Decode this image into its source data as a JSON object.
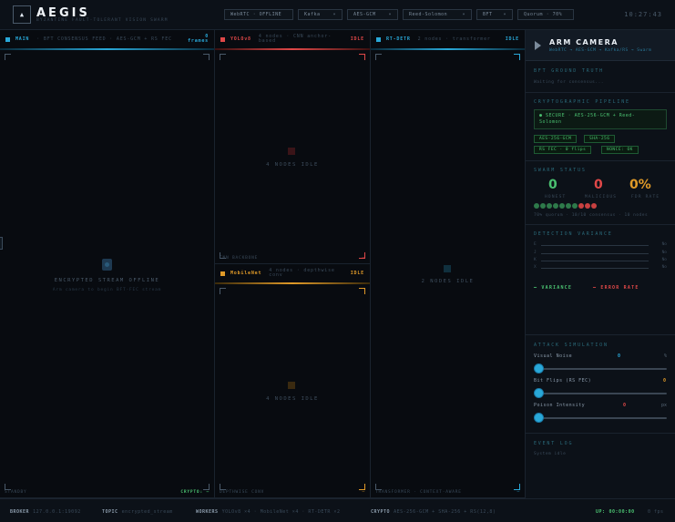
{
  "header": {
    "logo_glyph": "▲",
    "title": "AEGIS",
    "subtitle": "BYZANTINE FAULT-TOLERANT VISION SWARM",
    "pills": [
      {
        "label": "WebRTC · OFFLINE",
        "chev": ""
      },
      {
        "label": "Kafka",
        "chev": "▾"
      },
      {
        "label": "AES-GCM",
        "chev": "▾"
      },
      {
        "label": "Reed-Solomon",
        "chev": "▾"
      },
      {
        "label": "BFT",
        "chev": "▾"
      },
      {
        "label": "Quorum · 70%",
        "chev": ""
      }
    ],
    "clock": "10:27:43"
  },
  "main_panel": {
    "name": "MAIN",
    "desc": "· BFT CONSENSUS FEED · AES-GCM + RS FEC",
    "frames_num": "0",
    "frames_label": "frames",
    "color": "#29a8d8",
    "offline_title": "ENCRYPTED STREAM OFFLINE",
    "offline_sub": "Arm camera to begin BFT-FEC stream",
    "foot_left": "STANDBY",
    "foot_right_label": "CRYPTO:",
    "foot_right_val": "—"
  },
  "yolo_panel": {
    "name": "YOLOv8",
    "desc": "4 nodes · CNN anchor-based",
    "state": "IDLE",
    "color": "#e04848",
    "center": "4 NODES IDLE",
    "foot_left": "CNN BACKBONE",
    "foot_right": "—"
  },
  "rtdetr_panel": {
    "name": "RT-DETR",
    "desc": "2 nodes · transformer",
    "state": "IDLE",
    "color": "#29a8d8",
    "center": "2 NODES IDLE",
    "foot_left": "TRANSFORMER · CONTEXT-AWARE",
    "foot_right": "—"
  },
  "mobilenet_panel": {
    "name": "MobileNet",
    "desc": "4 nodes · depthwise conv",
    "state": "IDLE",
    "color": "#e09a28",
    "center": "4 NODES IDLE",
    "foot_left": "DEPTHWISE CONV",
    "foot_right": "—"
  },
  "sidebar": {
    "arm_title": "ARM CAMERA",
    "arm_sub": "WebRTC → AES-GCM → Kafka/RS → Swarm",
    "bft_title": "BFT GROUND TRUTH",
    "bft_text": "Waiting for consensus...",
    "crypto_title": "CRYPTOGRAPHIC PIPELINE",
    "crypto_secure_line1": "● SECURE · AES-256-GCM + Reed-",
    "crypto_secure_line2": "Solomon",
    "crypto_tags": [
      "AES-256-GCM",
      "SHA-256",
      "RS FEC · 0 flips",
      "NONCE: OK"
    ],
    "swarm_title": "SWARM STATUS",
    "honest_num": "0",
    "honest_label": "HONEST",
    "malicious_num": "0",
    "malicious_label": "MALICIOUS",
    "fdr_num": "0%",
    "fdr_label": "FDR RATE",
    "swarm_nodes": {
      "honest": 7,
      "malicious": 3
    },
    "swarm_text": "70% quorum · 10/10 consensus · 10 nodes",
    "variance_title": "DETECTION VARIANCE",
    "variance_rows": [
      {
        "label": "E",
        "value": "No"
      },
      {
        "label": "J",
        "value": "No"
      },
      {
        "label": "K",
        "value": "No"
      },
      {
        "label": "X",
        "value": "No"
      }
    ],
    "legend_variance": "━ VARIANCE",
    "legend_error": "━ ERROR RATE",
    "attack_title": "ATTACK SIMULATION",
    "sliders": [
      {
        "label": "Visual Noise",
        "value": "0",
        "unit": "%",
        "level": 0
      },
      {
        "label": "Bit Flips (RS FEC)",
        "value": "0",
        "unit": "",
        "level": 0
      },
      {
        "label": "Poison Intensity",
        "value": "0",
        "unit": "px",
        "level": 0
      }
    ],
    "event_title": "EVENT LOG",
    "event_text": "System idle"
  },
  "footer": {
    "broker_label": "BROKER",
    "broker_val": "127.0.0.1:19092",
    "topic_label": "TOPIC",
    "topic_val": "encrypted_stream",
    "workers_label": "WORKERS",
    "workers_val": "YOLOv8 ×4 · MobileNet ×4 · RT-DETR ×2",
    "crypto_label": "CRYPTO",
    "crypto_val": "AES-256-GCM + SHA-256 + RS(12,8)",
    "uptime_label": "UP:",
    "uptime_val": "00:00:00",
    "fps": "0 fps"
  },
  "colors": {
    "blue": "#29a8d8",
    "red": "#e04848",
    "orange": "#e09a28",
    "green": "#4ac070",
    "teal": "#2a6a7a"
  }
}
